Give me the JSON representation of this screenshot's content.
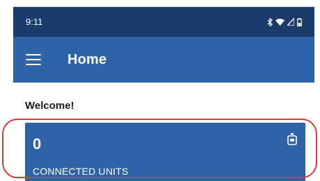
{
  "status_bar": {
    "time": "9:11",
    "icons": [
      "bluetooth-icon",
      "wifi-icon",
      "signal-icon",
      "battery-icon"
    ]
  },
  "app_bar": {
    "menu_icon": "hamburger-menu-icon",
    "title": "Home"
  },
  "content": {
    "welcome": "Welcome!"
  },
  "units_card": {
    "count": "0",
    "label": "CONNECTED UNITS",
    "icon": "device-icon"
  },
  "colors": {
    "status_bar": "#1b3b6a",
    "app_bar": "#2e63a8",
    "card": "#2e63a8",
    "highlight": "#d43a3a"
  }
}
